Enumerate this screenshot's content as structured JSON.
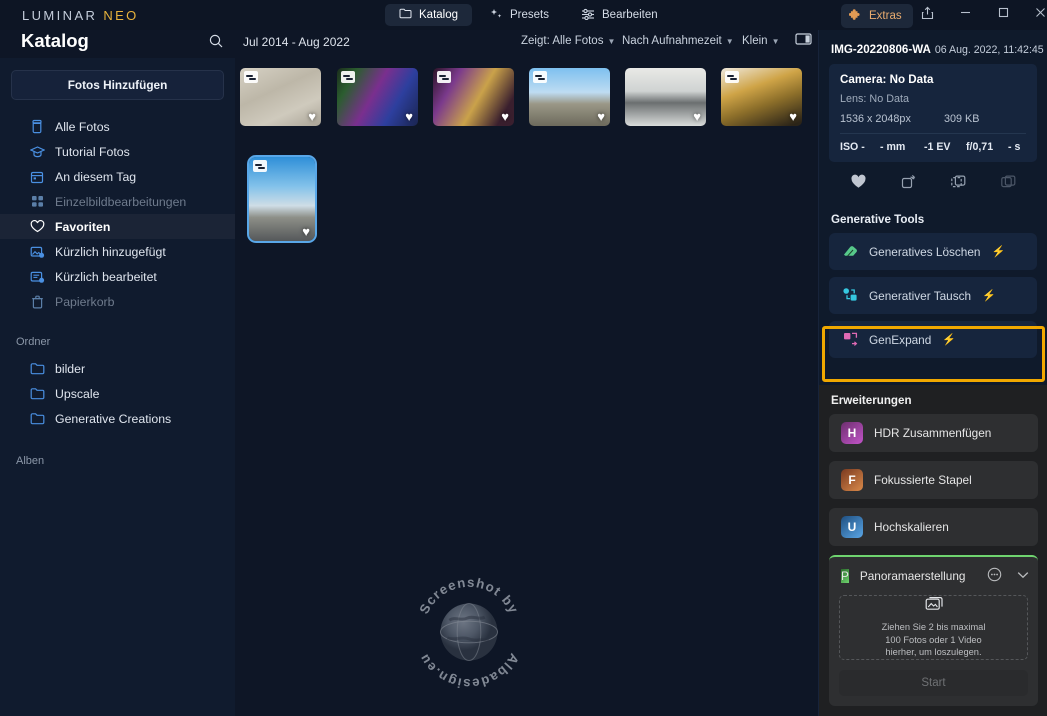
{
  "app": {
    "brand_main": "LUMINAR ",
    "brand_accent": "NEO"
  },
  "titlebar": {
    "tabs": [
      {
        "label": "Katalog",
        "icon": "folder-icon",
        "active": true
      },
      {
        "label": "Presets",
        "icon": "sparkle-icon",
        "active": false
      },
      {
        "label": "Bearbeiten",
        "icon": "sliders-icon",
        "active": false
      }
    ],
    "extras_label": "Extras",
    "extras_icon": "puzzle-icon",
    "share_icon": "share-icon",
    "minimize_icon": "minimize-icon",
    "maximize_icon": "maximize-icon",
    "close_icon": "close-icon"
  },
  "header": {
    "page_title": "Katalog",
    "search_icon": "search-icon",
    "date_range": "Jul 2014 - Aug 2022",
    "filter_label": "Zeigt: Alle Fotos",
    "sort_label": "Nach Aufnahmezeit",
    "size_label": "Klein",
    "panel_toggle_icon": "split-panel-icon"
  },
  "sidebar": {
    "add_photos_label": "Fotos Hinzufügen",
    "items": [
      {
        "label": "Alle Fotos",
        "icon": "archive-icon",
        "active": false,
        "dim": false
      },
      {
        "label": "Tutorial Fotos",
        "icon": "graduation-cap-icon",
        "active": false,
        "dim": false
      },
      {
        "label": "An diesem Tag",
        "icon": "calendar-icon",
        "active": false,
        "dim": false
      },
      {
        "label": "Einzelbildbearbeitungen",
        "icon": "grid-icon",
        "active": false,
        "dim": true
      },
      {
        "label": "Favoriten",
        "icon": "heart-icon",
        "active": true,
        "dim": false
      },
      {
        "label": "Kürzlich hinzugefügt",
        "icon": "image-clock-icon",
        "active": false,
        "dim": false
      },
      {
        "label": "Kürzlich bearbeitet",
        "icon": "list-clock-icon",
        "active": false,
        "dim": false
      },
      {
        "label": "Papierkorb",
        "icon": "trash-icon",
        "active": false,
        "dim": true
      }
    ],
    "folders_header": "Ordner",
    "folders": [
      {
        "label": "bilder",
        "icon": "folder-icon"
      },
      {
        "label": "Upscale",
        "icon": "folder-icon"
      },
      {
        "label": "Generative Creations",
        "icon": "folder-icon"
      }
    ],
    "albums_header": "Alben"
  },
  "grid": {
    "thumbnails": [
      {
        "name": "thumb-1",
        "favorite": true,
        "edited": true,
        "selected": false
      },
      {
        "name": "thumb-2",
        "favorite": true,
        "edited": true,
        "selected": false
      },
      {
        "name": "thumb-3",
        "favorite": true,
        "edited": true,
        "selected": false
      },
      {
        "name": "thumb-4",
        "favorite": true,
        "edited": true,
        "selected": false
      },
      {
        "name": "thumb-5",
        "favorite": true,
        "edited": true,
        "selected": false
      },
      {
        "name": "thumb-6",
        "favorite": true,
        "edited": true,
        "selected": false
      },
      {
        "name": "thumb-7",
        "favorite": true,
        "edited": true,
        "selected": true
      }
    ],
    "watermark_text": "Screenshot by Albadesign.eu"
  },
  "inspector": {
    "file_name": "IMG-20220806-WA",
    "capture_date": "06 Aug. 2022, 11:42:45",
    "camera": "Camera: No Data",
    "lens": "Lens: No Data",
    "dimensions": "1536 x 2048px",
    "file_size": "309 KB",
    "exposure": {
      "iso": "ISO -",
      "focal": "- mm",
      "ev": "-1 EV",
      "aperture": "f/0,71",
      "shutter": "- s"
    },
    "actions": [
      {
        "icon": "heart-icon",
        "name": "favorite-action"
      },
      {
        "icon": "rotate-icon",
        "name": "rotate-action"
      },
      {
        "icon": "copy-icon",
        "name": "duplicate-action"
      },
      {
        "icon": "stack-icon",
        "name": "stack-action"
      }
    ]
  },
  "generative_tools": {
    "header": "Generative Tools",
    "items": [
      {
        "label": "Generatives Löschen",
        "icon": "eraser-icon",
        "bolt": "⚡",
        "highlighted": false
      },
      {
        "label": "Generativer Tausch",
        "icon": "swap-icon",
        "bolt": "⚡",
        "highlighted": false
      },
      {
        "label": "GenExpand",
        "icon": "expand-icon",
        "bolt": "⚡",
        "highlighted": true
      }
    ],
    "highlight_color": "#f0a800"
  },
  "extensions": {
    "header": "Erweiterungen",
    "items": [
      {
        "label": "HDR Zusammenfügen",
        "badge": "H"
      },
      {
        "label": "Fokussierte Stapel",
        "badge": "F"
      },
      {
        "label": "Hochskalieren",
        "badge": "U"
      }
    ],
    "panorama": {
      "label": "Panoramaerstellung",
      "badge": "P",
      "more_icon": "more-circle-icon",
      "collapse_icon": "chevron-down-icon",
      "dropzone_icon": "photos-icon",
      "dropzone_line1": "Ziehen Sie 2 bis maximal",
      "dropzone_line2": "100 Fotos oder 1 Video",
      "dropzone_line3": "hierher, um loszulegen.",
      "start_label": "Start"
    }
  }
}
